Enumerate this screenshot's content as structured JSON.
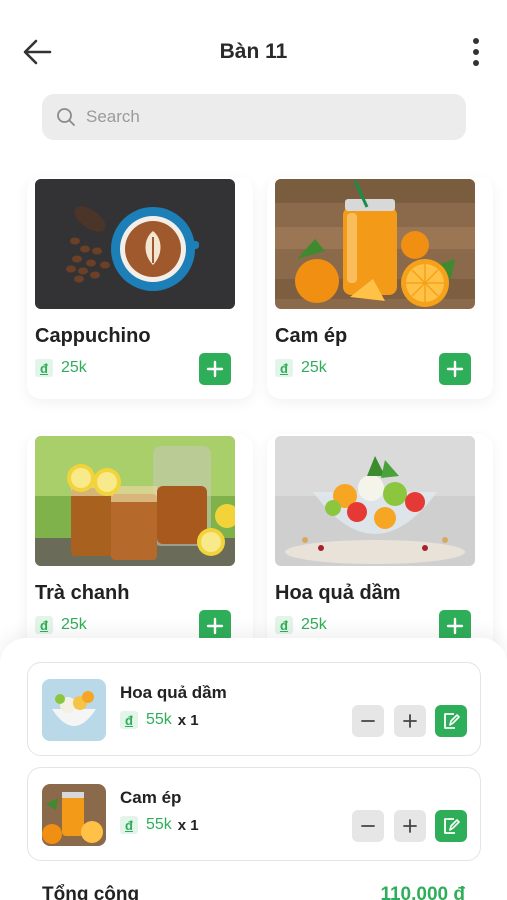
{
  "header": {
    "title": "Bàn 11"
  },
  "search": {
    "placeholder": "Search"
  },
  "products": [
    {
      "name": "Cappuchino",
      "price": "25k"
    },
    {
      "name": "Cam ép",
      "price": "25k"
    },
    {
      "name": "Trà chanh",
      "price": "25k"
    },
    {
      "name": "Hoa quả dầm",
      "price": "25k"
    }
  ],
  "currency_symbol": "đ",
  "cart": {
    "items": [
      {
        "name": "Hoa quả dầm",
        "price": "55k",
        "qty": "x 1"
      },
      {
        "name": "Cam ép",
        "price": "55k",
        "qty": "x 1"
      }
    ],
    "total_label": "Tổng cộng",
    "total_value": "110.000 đ"
  },
  "colors": {
    "accent": "#2fae5a",
    "accent_light": "#e3f5e8",
    "search_bg": "#ececec"
  },
  "icons": [
    "arrow-left-icon",
    "more-vertical-icon",
    "search-icon",
    "plus-icon",
    "minus-icon",
    "note-edit-icon",
    "dong-icon"
  ]
}
